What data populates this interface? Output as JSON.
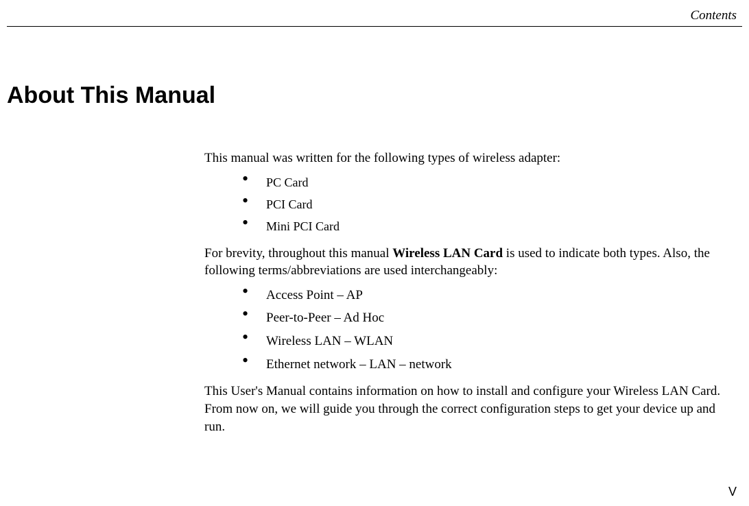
{
  "header_label": "Contents",
  "title": "About This Manual",
  "intro": "This manual was written for the following types of wireless adapter:",
  "adapter_list": [
    "PC Card",
    "PCI Card",
    "Mini PCI Card"
  ],
  "brevity_prefix": "For brevity, throughout this manual ",
  "brevity_bold": "Wireless LAN Card",
  "brevity_suffix": " is used to indicate both types. Also, the following terms/abbreviations are used interchangeably:",
  "terms_list": [
    "Access Point – AP",
    "Peer-to-Peer – Ad Hoc",
    "Wireless LAN – WLAN",
    "Ethernet network – LAN – network"
  ],
  "closing": "This User's Manual contains information on how to install and configure your Wireless LAN Card. From now on, we will guide you through the correct configuration steps to get your device up and run.",
  "page_number": "V"
}
